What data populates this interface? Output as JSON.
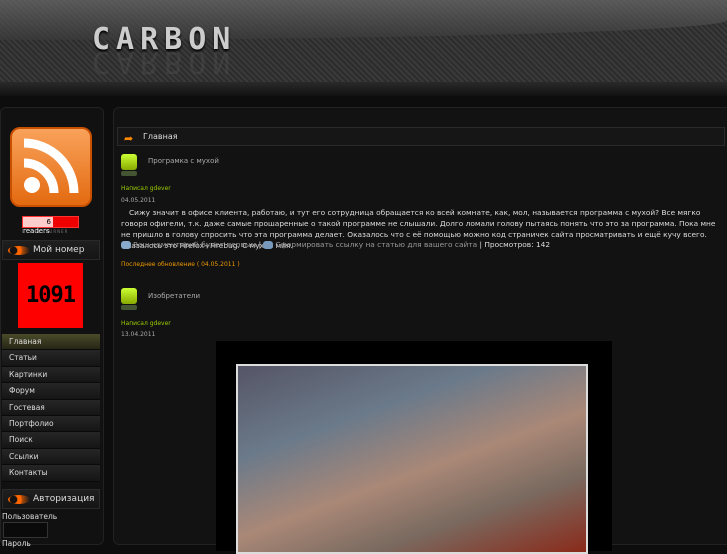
{
  "header": {
    "logo": "CARBON"
  },
  "sidebar": {
    "readers": {
      "count": "6",
      "label": "readers",
      "by": "BY FEEDBURNER"
    },
    "counter_title": "Мой номер",
    "counter_value": "1091",
    "menu": [
      {
        "label": "Главная"
      },
      {
        "label": "Статьи"
      },
      {
        "label": "Картинки"
      },
      {
        "label": "Форум"
      },
      {
        "label": "Гостевая"
      },
      {
        "label": "Портфолио"
      },
      {
        "label": "Поиск"
      },
      {
        "label": "Ссылки"
      },
      {
        "label": "Контакты"
      }
    ],
    "auth_title": "Авторизация",
    "user_label": "Пользователь",
    "pass_label": "Пароль"
  },
  "main": {
    "breadcrumb": "Главная",
    "posts": [
      {
        "title": "Програмка с мухой",
        "author": "Написал gdever",
        "date": "04.05.2011",
        "body": "Сижу значит в офисе клиента, работаю, и тут его сотрудница обращается ко всей комнате, как, мол, называется программа с мухой? Все мягко говоря офигели, т.к. даже самые прошаренные о такой программе не слышали. Долго ломали голову пытаясь понять что это за программа. Пока мне не пришло в голову спросить что эта программа делает. Оказалось что с её помощью можно код страничек сайта просматривать и ещё кучу всего. Оказалось это Firefox+Firebug. С мухой мля.",
        "comment_link": "Ваш коментарий будет первым",
        "link_link": "Сформировать ссылку на статью для вашего сайта",
        "views": "Просмотров: 142",
        "updated": "Последнее обновление ( 04.05.2011 )"
      },
      {
        "title": "Изобретатели",
        "author": "Написал gdever",
        "date": "13.04.2011"
      }
    ]
  },
  "colors": {
    "accent": "#ff6600",
    "author": "#99cc00",
    "counter": "#ff0000"
  }
}
